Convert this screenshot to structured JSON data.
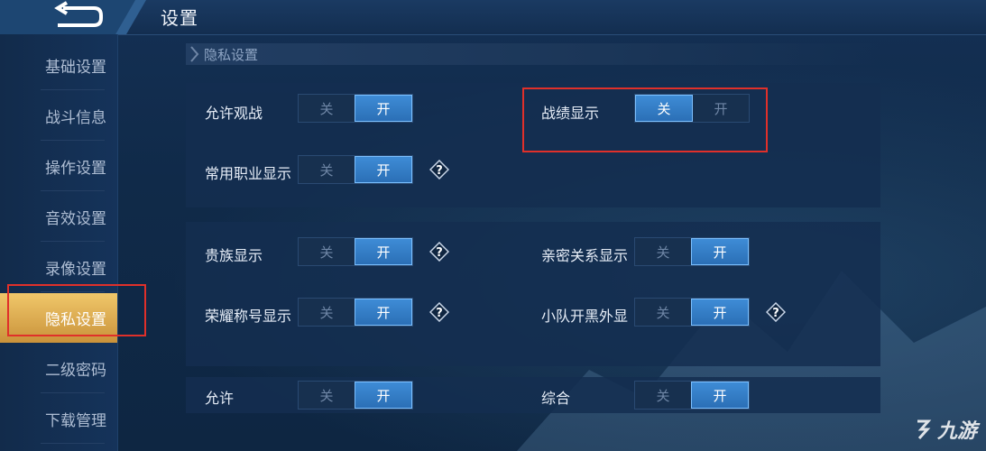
{
  "header": {
    "title": "设置"
  },
  "sidebar": {
    "items": [
      {
        "label": "基础设置",
        "active": false
      },
      {
        "label": "战斗信息",
        "active": false
      },
      {
        "label": "操作设置",
        "active": false
      },
      {
        "label": "音效设置",
        "active": false
      },
      {
        "label": "录像设置",
        "active": false
      },
      {
        "label": "隐私设置",
        "active": true
      },
      {
        "label": "二级密码",
        "active": false
      },
      {
        "label": "下载管理",
        "active": false
      }
    ]
  },
  "section": {
    "title": "隐私设置"
  },
  "toggle_labels": {
    "off": "关",
    "on": "开"
  },
  "settings": {
    "allow_spectate": {
      "label": "允许观战",
      "value": "开"
    },
    "record_display": {
      "label": "战绩显示",
      "value": "关"
    },
    "common_role_display": {
      "label": "常用职业显示",
      "value": "开"
    },
    "noble_display": {
      "label": "贵族显示",
      "value": "开"
    },
    "intimacy_display": {
      "label": "亲密关系显示",
      "value": "开"
    },
    "honor_title_display": {
      "label": "荣耀称号显示",
      "value": "开"
    },
    "squad_display": {
      "label": "小队开黑外显",
      "value": "开"
    },
    "partial_row_left": {
      "label": "允许",
      "value": "开"
    },
    "partial_row_right": {
      "label": "综合",
      "value": "开"
    }
  },
  "help_icon": {
    "symbol": "?",
    "icon": "question-diamond-icon"
  },
  "watermark": {
    "text": "九游",
    "icon": "jiuyou-logo-icon"
  },
  "colors": {
    "accent": "#2b6fb6",
    "active_tab": "#d9a44a",
    "highlight": "#e0302a"
  }
}
